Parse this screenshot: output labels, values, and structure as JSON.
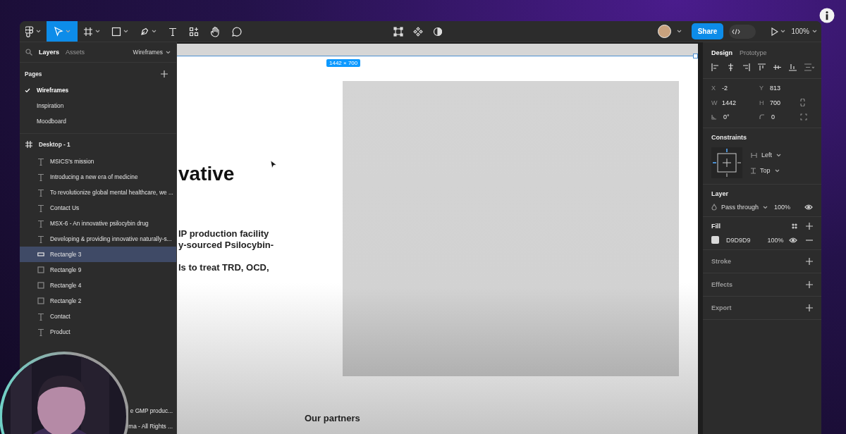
{
  "toolbar": {
    "tools": [
      {
        "kind": "main-menu",
        "dropdown": true,
        "selected": false
      },
      {
        "kind": "move",
        "dropdown": true,
        "selected": true
      },
      {
        "kind": "frame",
        "dropdown": true,
        "selected": false
      },
      {
        "kind": "shape",
        "dropdown": true,
        "selected": false
      },
      {
        "kind": "pen",
        "dropdown": true,
        "selected": false
      },
      {
        "kind": "text",
        "dropdown": false,
        "selected": false
      },
      {
        "kind": "resources",
        "dropdown": false,
        "selected": false
      },
      {
        "kind": "hand",
        "dropdown": false,
        "selected": false
      },
      {
        "kind": "comment",
        "dropdown": false,
        "selected": false
      }
    ],
    "center_tools": [
      {
        "kind": "transform"
      },
      {
        "kind": "component"
      },
      {
        "kind": "contrast"
      }
    ],
    "share": "Share",
    "dev_mode": {
      "on": false
    },
    "zoom": "100%"
  },
  "left_panel": {
    "tabs": [
      {
        "label": "Layers",
        "selected": true
      },
      {
        "label": "Assets",
        "selected": false
      }
    ],
    "page_switcher": "Wireframes",
    "pages_title": "Pages",
    "pages": [
      {
        "label": "Wireframes",
        "selected": true
      },
      {
        "label": "Inspiration",
        "selected": false
      },
      {
        "label": "Moodboard",
        "selected": false
      }
    ],
    "layers": [
      {
        "name": "Desktop - 1",
        "kind": "frame",
        "children": [
          {
            "name": "MSICS's mission",
            "kind": "text",
            "selected": false
          },
          {
            "name": "Introducing a new era of medicine",
            "kind": "text",
            "selected": false
          },
          {
            "name": "To revolutionize global mental healthcare, we ...",
            "kind": "text",
            "selected": false
          },
          {
            "name": "Contact Us",
            "kind": "text",
            "selected": false
          },
          {
            "name": "MSX-6 - An innovative psilocybin drug",
            "kind": "text",
            "selected": false
          },
          {
            "name": "Developing & providing innovative naturally-s...",
            "kind": "text",
            "selected": false
          },
          {
            "name": "Rectangle 3",
            "kind": "wide-rectangle",
            "selected": true
          },
          {
            "name": "Rectangle 9",
            "kind": "rectangle",
            "selected": false
          },
          {
            "name": "Rectangle 4",
            "kind": "rectangle",
            "selected": false
          },
          {
            "name": "Rectangle 2",
            "kind": "rectangle",
            "selected": false
          },
          {
            "name": "Contact",
            "kind": "text",
            "selected": false
          },
          {
            "name": "Product",
            "kind": "text",
            "selected": false
          }
        ]
      }
    ],
    "covered_layers": [
      {
        "name": "e GMP produc..."
      },
      {
        "name": "ma - All Rights ..."
      }
    ]
  },
  "canvas": {
    "frame_size": "1442 × 700",
    "heading": "vative",
    "paragraph": "IP production facility\ny-sourced Psilocybin-\n\nls to treat TRD, OCD,",
    "partners": "Our partners"
  },
  "right_panel": {
    "tabs": [
      {
        "label": "Design",
        "selected": true
      },
      {
        "label": "Prototype",
        "selected": false
      }
    ],
    "fields": [
      {
        "label": "X",
        "value": "-2"
      },
      {
        "label": "Y",
        "value": "813"
      },
      {
        "label": "W",
        "value": "1442"
      },
      {
        "label": "H",
        "value": "700"
      },
      {
        "kind": "rotation",
        "value": "0°"
      },
      {
        "kind": "radius",
        "value": "0"
      }
    ],
    "constraints": {
      "title": "Constraints",
      "horizontal": "Left",
      "vertical": "Top"
    },
    "layer": {
      "title": "Layer",
      "blend": "Pass through",
      "opacity": "100%"
    },
    "fill": {
      "title": "Fill",
      "color": "D9D9D9",
      "opacity": "100%"
    },
    "sections": [
      "Stroke",
      "Effects",
      "Export"
    ]
  }
}
